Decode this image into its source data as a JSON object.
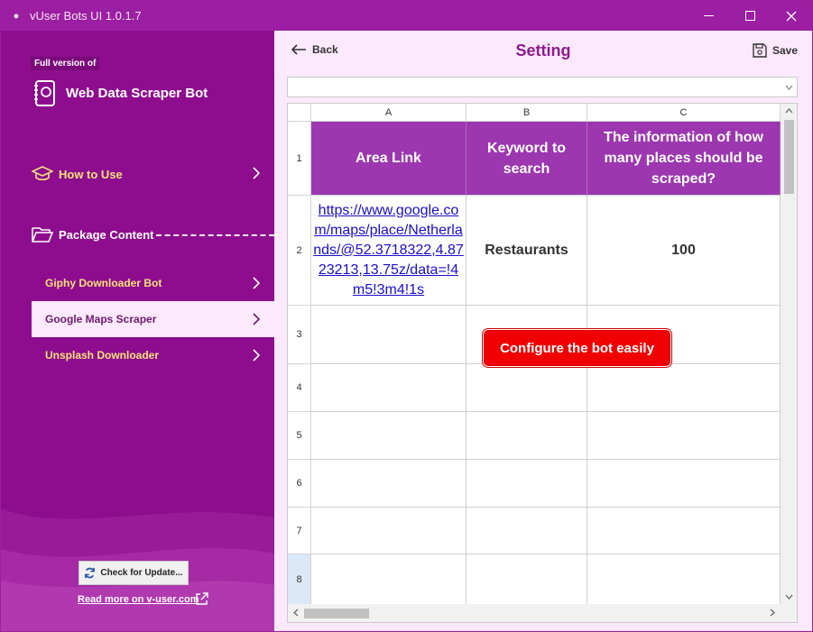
{
  "window": {
    "title": "vUser Bots UI 1.0.1.7"
  },
  "sidebar": {
    "badge": "Full version of",
    "bot_name": "Web Data Scraper Bot",
    "how_to_use": "How to Use",
    "package_content": "Package Content",
    "packages": [
      {
        "label": "Giphy Downloader Bot",
        "selected": false
      },
      {
        "label": "Google Maps Scraper",
        "selected": true
      },
      {
        "label": "Unsplash Downloader",
        "selected": false
      }
    ],
    "update_button": "Check for Update...",
    "read_more": "Read more on v-user.com"
  },
  "toolbar": {
    "back_label": "Back",
    "title": "Setting",
    "save_label": "Save"
  },
  "sheet_select": {
    "value": ""
  },
  "spreadsheet": {
    "columns": [
      "A",
      "B",
      "C"
    ],
    "rows": [
      "1",
      "2",
      "3",
      "4",
      "5",
      "6",
      "7",
      "8"
    ],
    "header_cells": [
      "Area Link",
      "Keyword to search",
      "The information of how many places should be scraped?"
    ],
    "row2": {
      "link": "https://www.google.com/maps/place/Netherlands/@52.3718322,4.8723213,13.75z/data=!4m5!3m4!1s",
      "keyword": "Restaurants",
      "count": "100"
    }
  },
  "callout": "Configure the bot easily",
  "colors": {
    "accent": "#9c1ea2",
    "sidebar": "#8e0d8e",
    "header_cell": "#9c37b0",
    "callout": "#f00000"
  }
}
